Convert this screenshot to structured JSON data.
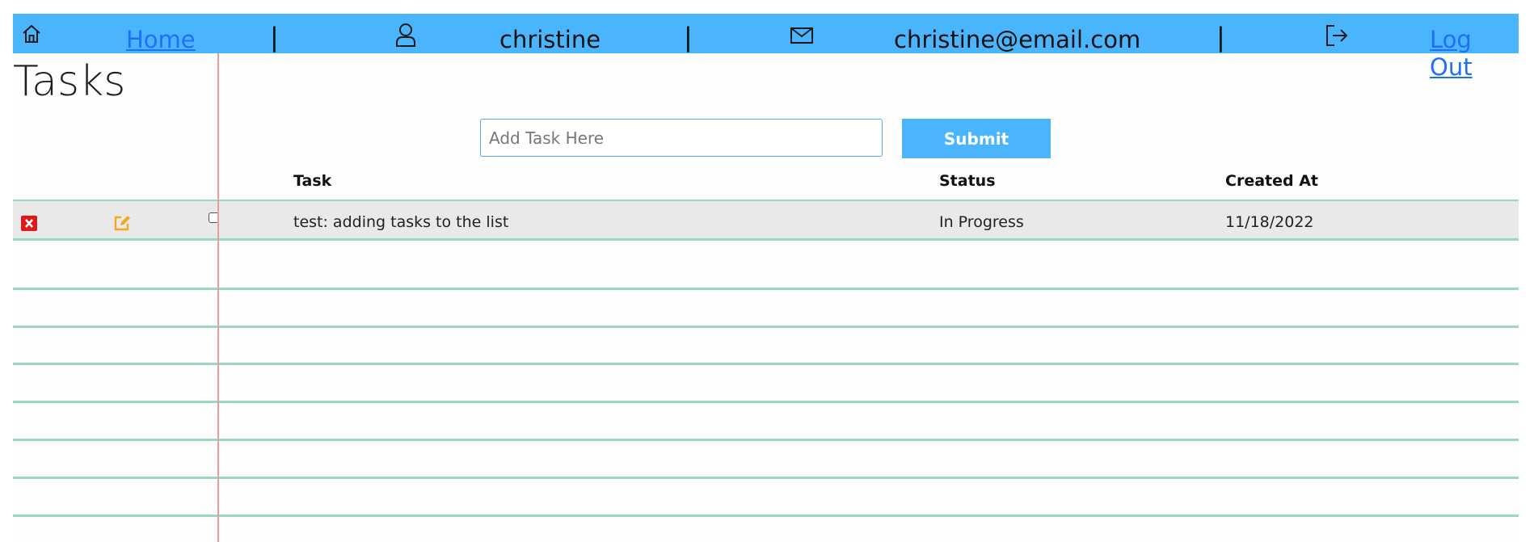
{
  "nav": {
    "home_label": "Home",
    "username": "christine",
    "email": "christine@email.com",
    "separator": "|",
    "logout_label": "Log Out",
    "icons": [
      "home-icon",
      "user-icon",
      "mail-icon",
      "logout-icon"
    ]
  },
  "page": {
    "title": "Tasks"
  },
  "form": {
    "placeholder": "Add Task Here",
    "value": "",
    "submit_label": "Submit"
  },
  "table": {
    "headers": [
      "Task",
      "Status",
      "Created At"
    ],
    "rows": [
      {
        "task": "test: adding tasks to the list",
        "status": "In Progress",
        "created_at": "11/18/2022",
        "checked": false
      }
    ]
  },
  "colors": {
    "nav_bg": "#4ab5fd",
    "link": "#1e6fff",
    "delete": "#e01919",
    "edit": "#f5a623",
    "ruled_line": "#9bd7c6",
    "margin_line": "#ee9b9b"
  }
}
